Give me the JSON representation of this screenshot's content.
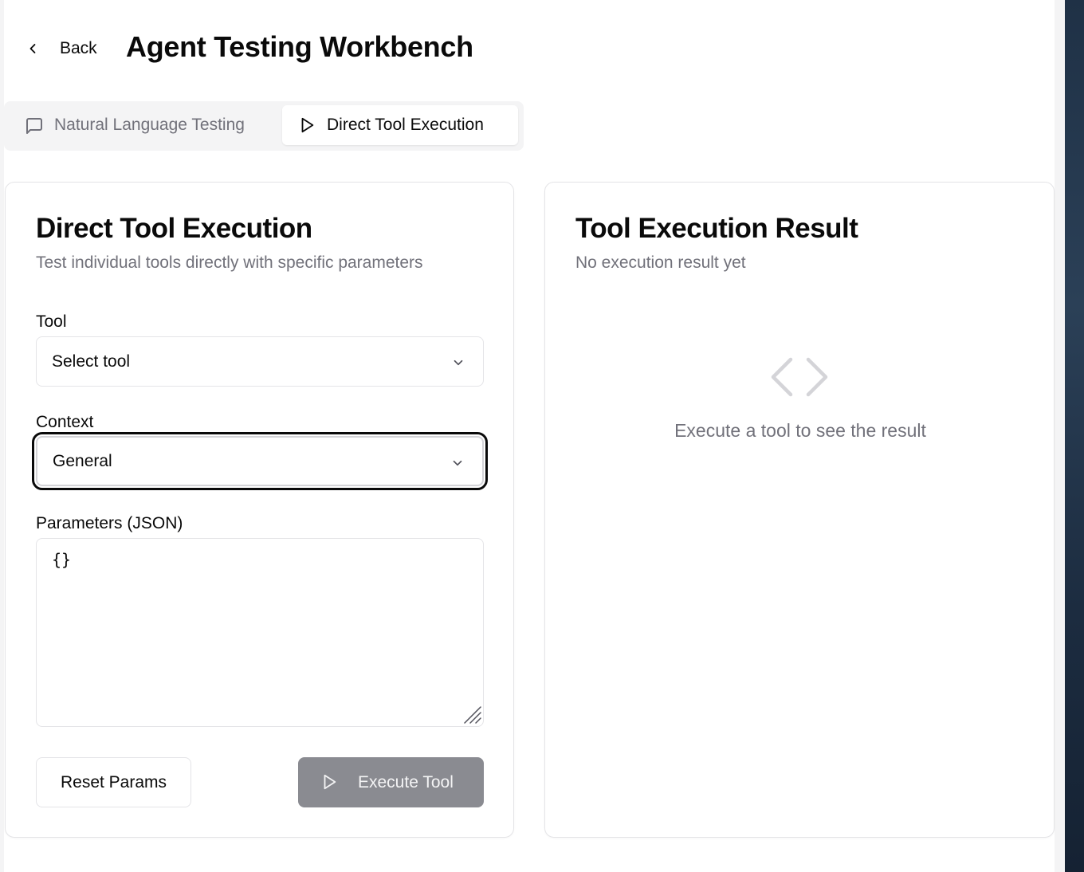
{
  "header": {
    "back_label": "Back",
    "title": "Agent Testing Workbench"
  },
  "tabs": [
    {
      "label": "Natural Language Testing",
      "icon": "message-square-icon",
      "active": false
    },
    {
      "label": "Direct Tool Execution",
      "icon": "play-icon",
      "active": true
    }
  ],
  "execution_panel": {
    "title": "Direct Tool Execution",
    "description": "Test individual tools directly with specific parameters",
    "tool": {
      "label": "Tool",
      "value": "Select tool"
    },
    "context": {
      "label": "Context",
      "value": "General"
    },
    "parameters": {
      "label": "Parameters (JSON)",
      "value": "{}"
    },
    "reset_label": "Reset Params",
    "execute_label": "Execute Tool"
  },
  "result_panel": {
    "title": "Tool Execution Result",
    "description": "No execution result yet",
    "empty_icon": "code-icon",
    "empty_text": "Execute a tool to see the result"
  },
  "colors": {
    "accent_dark": "#0a0a0a",
    "muted_text": "#71717a",
    "border": "#e4e4e7",
    "disabled_button": "#8a8b91",
    "tab_background": "#f4f4f5"
  }
}
